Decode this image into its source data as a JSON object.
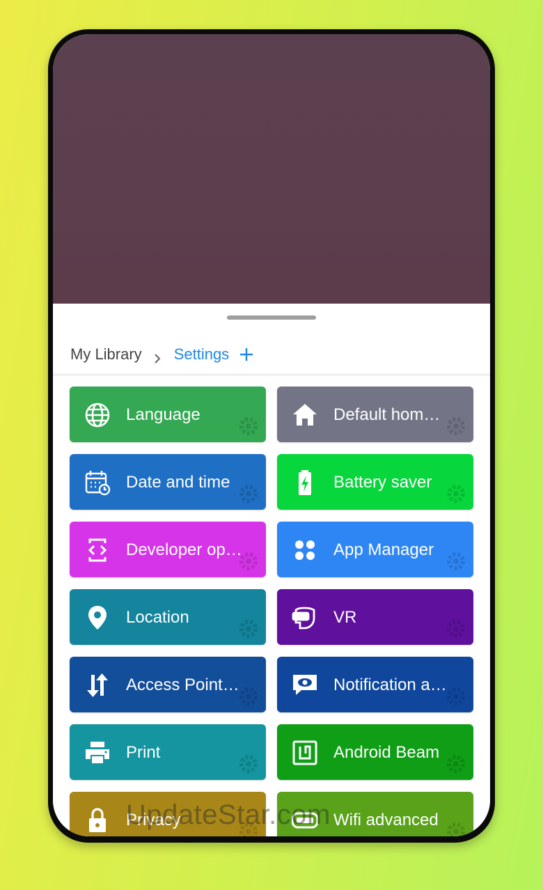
{
  "breadcrumb": {
    "root": "My Library",
    "current": "Settings"
  },
  "tiles": [
    {
      "label": "Language",
      "icon": "globe-icon",
      "color": "#34a853"
    },
    {
      "label": "Default hom…",
      "icon": "home-icon",
      "color": "#737586"
    },
    {
      "label": "Date and time",
      "icon": "calendar-clock-icon",
      "color": "#1f6fc4"
    },
    {
      "label": "Battery saver",
      "icon": "battery-icon",
      "color": "#07d63c"
    },
    {
      "label": "Developer op…",
      "icon": "developer-code-icon",
      "color": "#d634e8"
    },
    {
      "label": "App Manager",
      "icon": "apps-grid-icon",
      "color": "#2e86f5"
    },
    {
      "label": "Location",
      "icon": "location-pin-icon",
      "color": "#14859d"
    },
    {
      "label": "VR",
      "icon": "vr-headset-icon",
      "color": "#5f119e"
    },
    {
      "label": "Access Point…",
      "icon": "swap-arrows-icon",
      "color": "#134e9b"
    },
    {
      "label": "Notification a…",
      "icon": "eye-message-icon",
      "color": "#10479d"
    },
    {
      "label": "Print",
      "icon": "printer-icon",
      "color": "#14959f"
    },
    {
      "label": "Android Beam",
      "icon": "nfc-icon",
      "color": "#0f9e16"
    },
    {
      "label": "Privacy",
      "icon": "lock-icon",
      "color": "#a88718"
    },
    {
      "label": "Wifi advanced",
      "icon": "wifi-badge-icon",
      "color": "#59a21a"
    }
  ],
  "watermark": "UpdateStar.com"
}
